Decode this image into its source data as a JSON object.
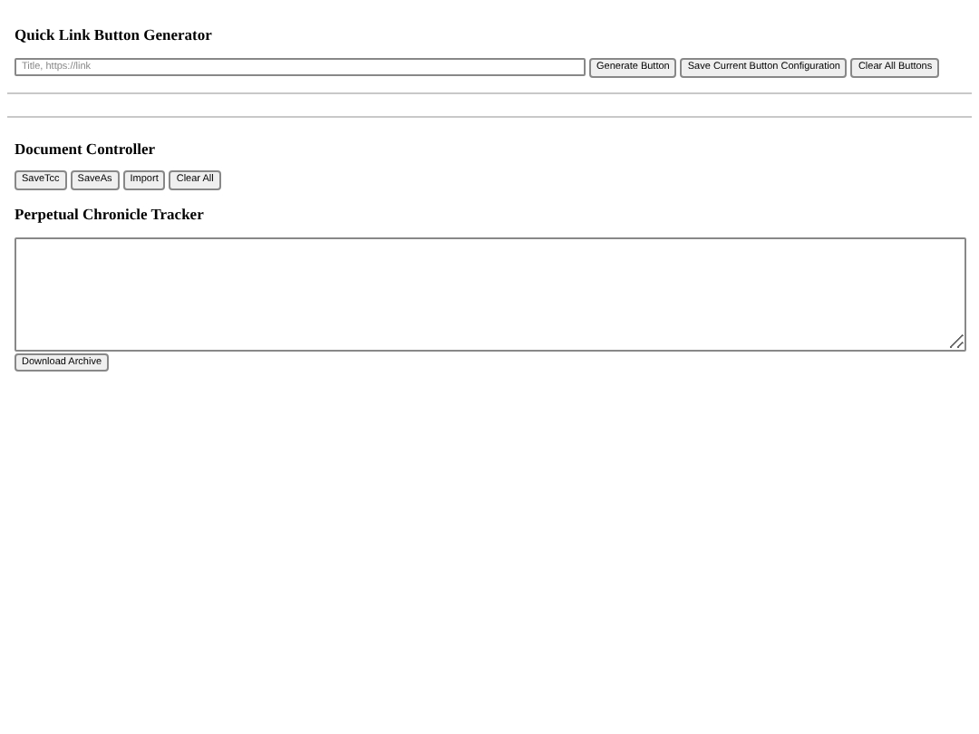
{
  "link_generator": {
    "title": "Quick Link Button Generator",
    "input": {
      "placeholder": "Title, https://link"
    },
    "buttons": [
      "Generate Button",
      "Save Current Button Configuration",
      "Clear All Buttons"
    ]
  },
  "document_controller": {
    "title": "Document Controller",
    "buttons": [
      "SaveTcc",
      "SaveAs",
      "Import",
      "Clear All"
    ]
  },
  "chronicle_tracker": {
    "title": "Perpetual Chronicle Tracker",
    "buttons": [
      "Download Archive"
    ]
  }
}
